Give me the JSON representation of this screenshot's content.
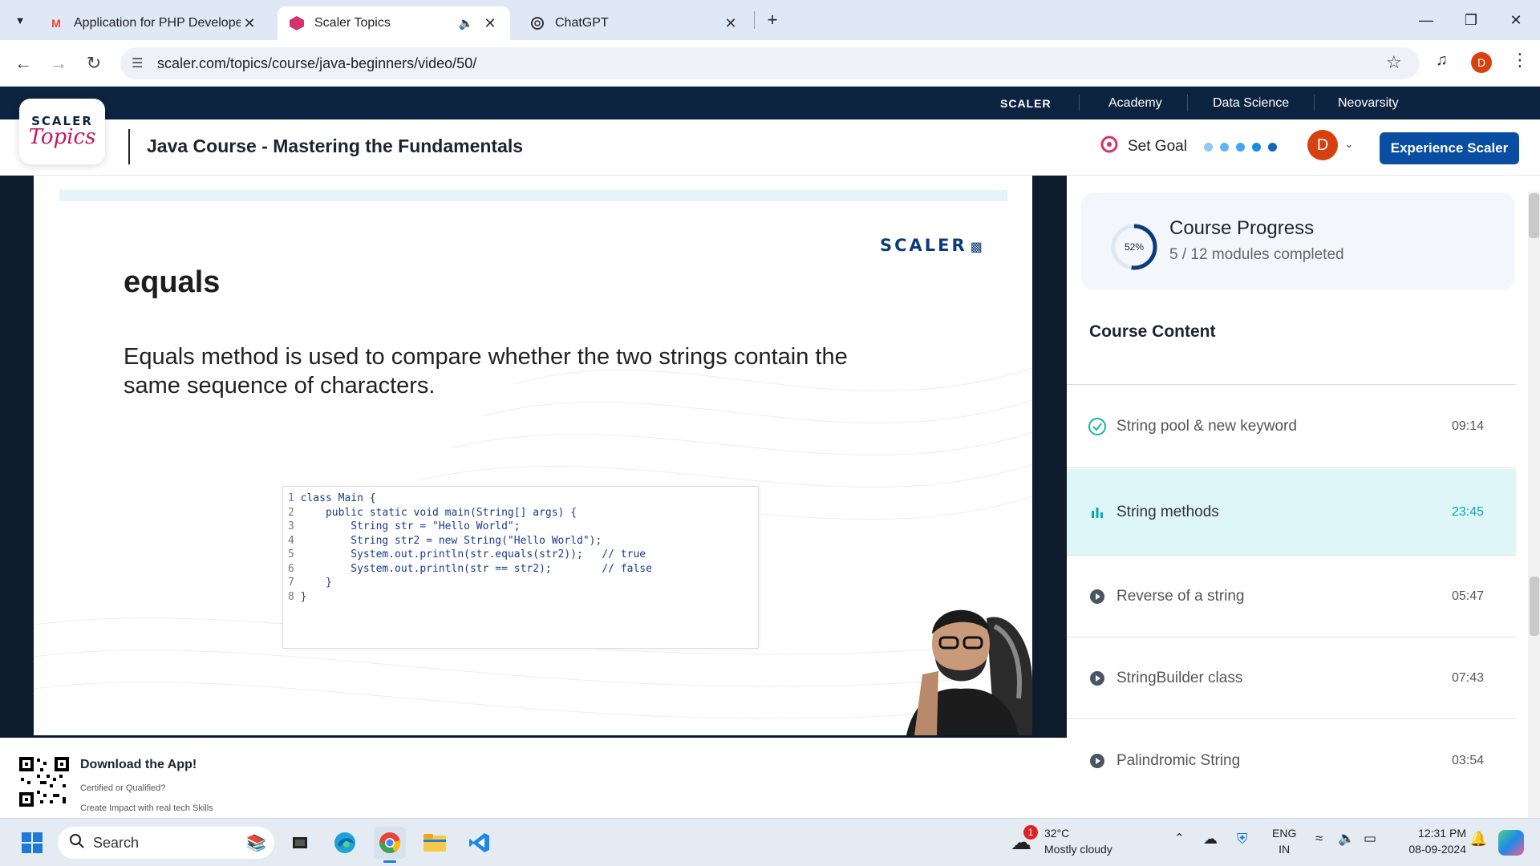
{
  "browser": {
    "tabs": [
      {
        "title": "Application for PHP Developer",
        "favicon": "gmail-icon",
        "active": false
      },
      {
        "title": "Scaler Topics",
        "favicon": "scaler-icon",
        "active": true
      },
      {
        "title": "ChatGPT",
        "favicon": "chatgpt-icon",
        "active": false
      }
    ],
    "url": "scaler.com/topics/course/java-beginners/video/50/",
    "profile_initial": "D"
  },
  "site": {
    "top_nav": [
      "SCALER",
      "Academy",
      "Data Science",
      "Neovarsity"
    ],
    "logo_line1": "SCALER",
    "logo_line2": "Topics",
    "course_title": "Java Course - Mastering the Fundamentals",
    "set_goal": "Set Goal",
    "avatar_initial": "D",
    "cta": "Experience Scaler",
    "accent": "#0a4ea3",
    "brand_pink": "#c2185b"
  },
  "slide": {
    "logo": "SCALER",
    "heading": "equals",
    "description": "Equals method is used to compare whether the two strings contain the same sequence of characters.",
    "code_lines": [
      "class Main {",
      "    public static void main(String[] args) {",
      "        String str = \"Hello World\";",
      "        String str2 = new String(\"Hello World\");",
      "        System.out.println(str.equals(str2));   // true",
      "        System.out.println(str == str2);        // false",
      "    }",
      "}"
    ]
  },
  "app_banner": {
    "title": "Download the App!",
    "sub1": "Certified or Qualified?",
    "sub2": "Create Impact with real tech Skills"
  },
  "progress": {
    "percent_label": "52%",
    "percent": 52,
    "title": "Course Progress",
    "subtitle": "5 / 12 modules completed"
  },
  "course_content": {
    "title": "Course Content",
    "lessons": [
      {
        "name": "String pool & new keyword",
        "duration": "09:14",
        "state": "completed"
      },
      {
        "name": "String methods",
        "duration": "23:45",
        "state": "playing"
      },
      {
        "name": "Reverse of a string",
        "duration": "05:47",
        "state": "pending"
      },
      {
        "name": "StringBuilder class",
        "duration": "07:43",
        "state": "pending"
      },
      {
        "name": "Palindromic String",
        "duration": "03:54",
        "state": "pending"
      }
    ]
  },
  "taskbar": {
    "search": "Search",
    "weather_temp": "32°C",
    "weather_cond": "Mostly cloudy",
    "weather_badge": "1",
    "lang1": "ENG",
    "lang2": "IN",
    "time": "12:31 PM",
    "date": "08-09-2024"
  }
}
